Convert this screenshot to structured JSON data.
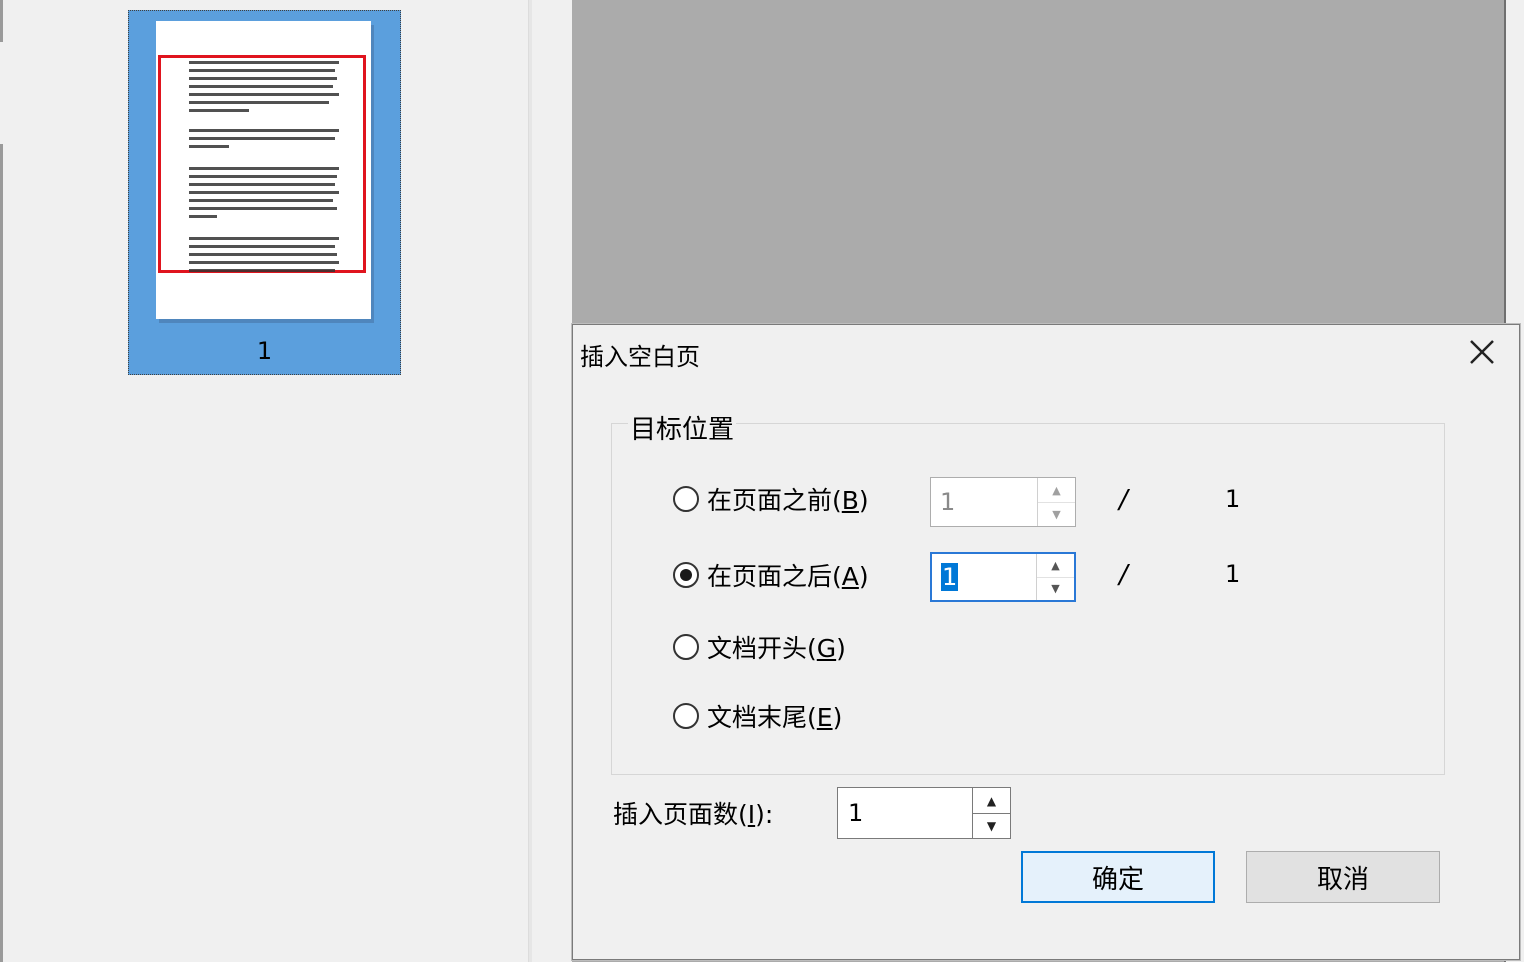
{
  "thumbnail": {
    "page_number": "1"
  },
  "dialog": {
    "title": "插入空白页",
    "group_title": "目标位置",
    "options": [
      {
        "text": "在页面之前(",
        "key": "B",
        "tail": ")",
        "checked": false,
        "page_value": "1",
        "total": "1"
      },
      {
        "text": "在页面之后(",
        "key": "A",
        "tail": ")",
        "checked": true,
        "page_value": "1",
        "total": "1"
      },
      {
        "text": "文档开头(",
        "key": "G",
        "tail": ")",
        "checked": false
      },
      {
        "text": "文档末尾(",
        "key": "E",
        "tail": ")",
        "checked": false
      }
    ],
    "separator": "/",
    "page_count": {
      "label_pre": "插入页面数(",
      "key": "I",
      "label_post": "):",
      "value": "1"
    },
    "ok_label": "确定",
    "cancel_label": "取消"
  }
}
